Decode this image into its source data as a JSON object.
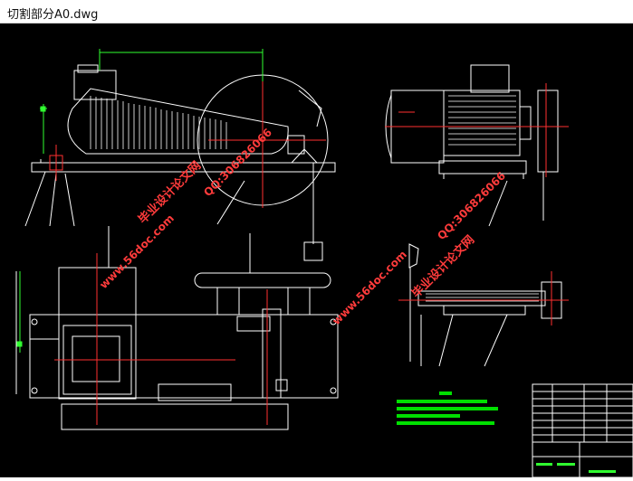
{
  "window": {
    "title": "切割部分A0.dwg"
  },
  "watermarks": {
    "site": "www.56doc.com",
    "qq": "QQ:306826066",
    "brand": "毕业设计论文网"
  },
  "colors": {
    "background": "#000000",
    "line": "#ffffff",
    "center_line": "#ff3030",
    "dimension": "#30ff30",
    "notes": "#00e000",
    "watermark": "#ff3b3b"
  }
}
